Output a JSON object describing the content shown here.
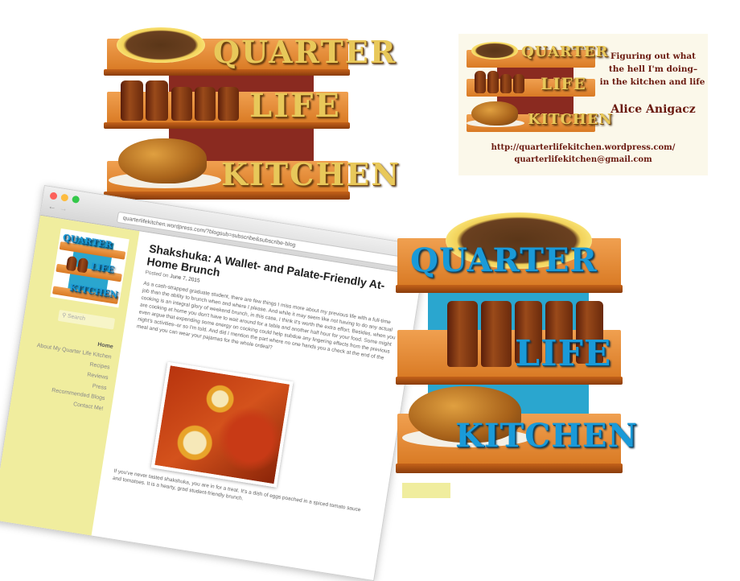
{
  "logo_gold": {
    "word1": "QUARTER",
    "word2": "LIFE",
    "word3": "KITCHEN",
    "colors": {
      "text": "#e8c85a",
      "wall": "#8a2a20",
      "shelf": "#d97a24"
    }
  },
  "business_card": {
    "logo_word1": "QUARTER",
    "logo_word2": "LIFE",
    "logo_word3": "KITCHEN",
    "tagline_line1": "Figuring out what",
    "tagline_line2": "the hell I'm doing–",
    "tagline_line3": "in the kitchen and life",
    "name": "Alice Anigacz",
    "url": "http://quarterlifekitchen.wordpress.com/",
    "email": "quarterlifekitchen@gmail.com",
    "colors": {
      "background": "#fbf8ea",
      "text": "#6a1a10"
    }
  },
  "browser": {
    "url": "quarterlifekitchen.wordpress.com/?blogsub=subscribe&subscribe-blog",
    "sidebar": {
      "logo_word1": "QUARTER",
      "logo_word2": "LIFE",
      "logo_word3": "KITCHEN",
      "search_placeholder": "Search",
      "nav": [
        {
          "label": "Home"
        },
        {
          "label": "About My Quarter Life Kitchen"
        },
        {
          "label": "Recipes"
        },
        {
          "label": "Reviews"
        },
        {
          "label": "Press"
        },
        {
          "label": "Recommended Blogs"
        },
        {
          "label": "Contact Me!"
        }
      ]
    },
    "post": {
      "title": "Shakshuka: A Wallet- and Palate-Friendly At-Home Brunch",
      "meta_prefix": "Posted on",
      "date": "June 7, 2015",
      "body": "As a cash-strapped graduate student, there are few things I miss more about my previous life with a full-time job than the ability to brunch when and where I please. And while it may seem like not having to do any actual cooking is an integral glory of weekend brunch, in this case, I think it's worth the extra effort. Besides, when you are cooking at home you don't have to wait around for a table and another half hour for your food. Some might even argue that expending some energy on cooking could help subdue any lingering effects from the previous night's activities–or so I'm told. And did I mention the part where no one hands you a check at the end of the meal and you can wear your pajamas for the whole ordeal?",
      "after_image": "If you've never tasted shakshuka, you are in for a treat. It's a dish of eggs poached in a spiced tomato sauce and tomatoes. It is a hearty, grad student-friendly brunch."
    },
    "colors": {
      "sidebar": "#f0ed9e"
    }
  },
  "logo_blue": {
    "word1": "QUARTER",
    "word2": "LIFE",
    "word3": "KITCHEN",
    "colors": {
      "text": "#1a9ad8",
      "wall": "#2aa6cf",
      "shelf": "#d97a24"
    }
  }
}
